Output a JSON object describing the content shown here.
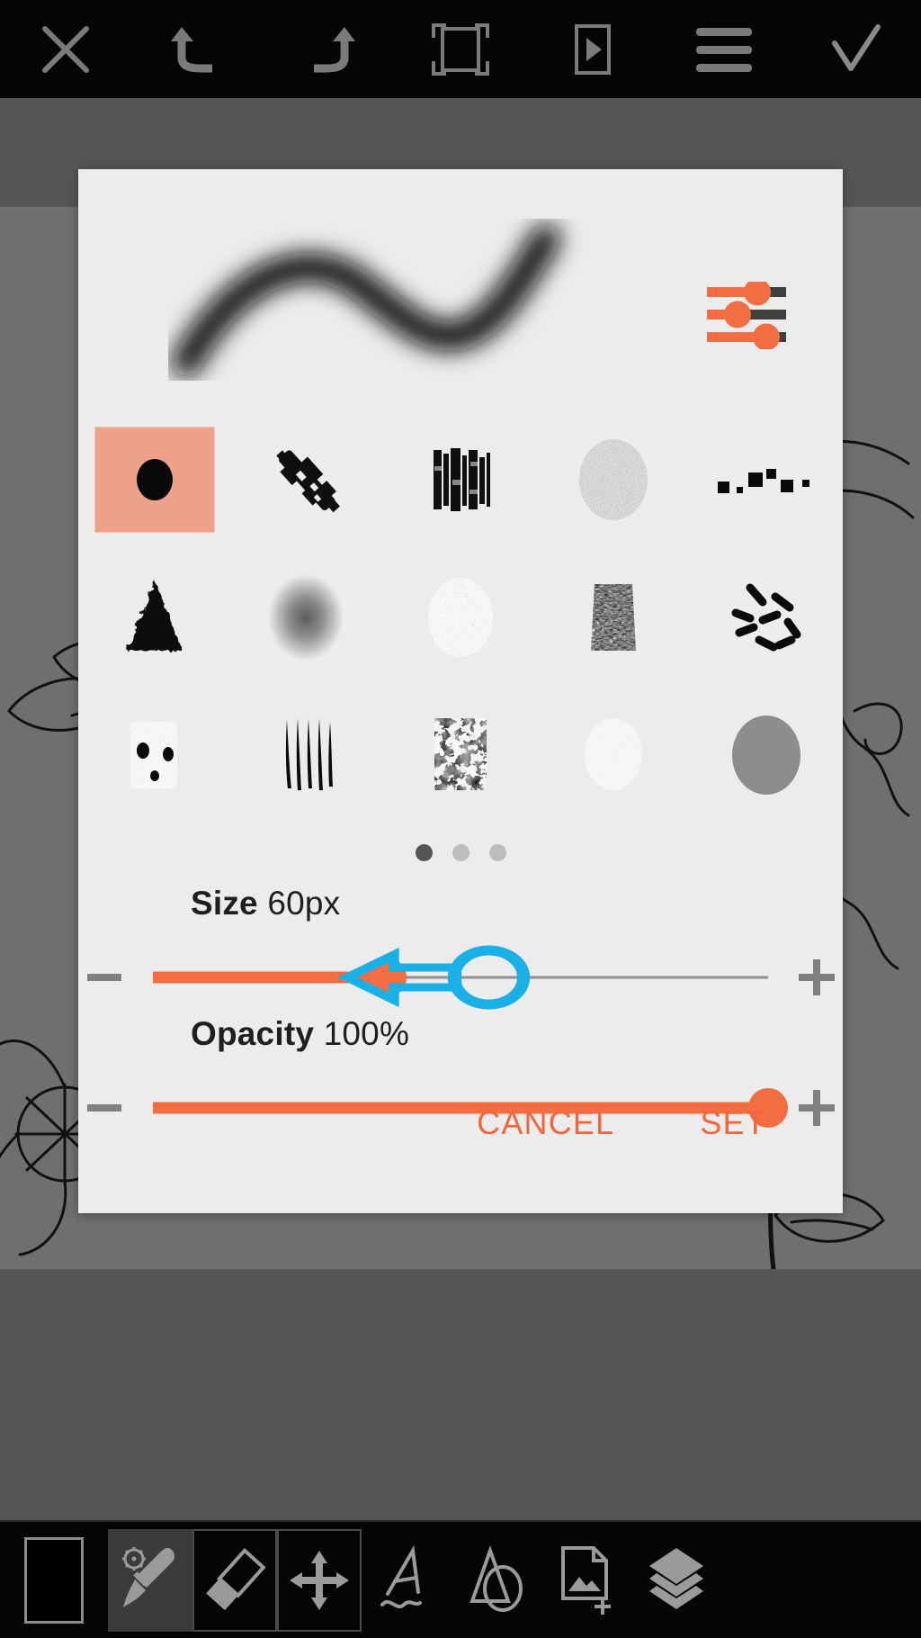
{
  "app": {
    "accent_color": "#f26d42",
    "dialog_bg": "#ececec",
    "toolbar_bg": "#050505",
    "canvas_bg": "#6f6f6f",
    "annotation_color": "#19b0e8",
    "selected_brush_highlight": "#eda18a"
  },
  "top_toolbar": {
    "items": [
      {
        "name": "close-icon",
        "label": "Close"
      },
      {
        "name": "undo-icon",
        "label": "Undo"
      },
      {
        "name": "redo-icon",
        "label": "Redo"
      },
      {
        "name": "crop-icon",
        "label": "Crop"
      },
      {
        "name": "preview-icon",
        "label": "Preview"
      },
      {
        "name": "menu-icon",
        "label": "Menu"
      },
      {
        "name": "confirm-check-icon",
        "label": "Done"
      }
    ]
  },
  "dialog": {
    "title": "Brush settings",
    "preview": {
      "name": "brush-stroke-preview"
    },
    "settings_icon": {
      "name": "brush-settings-sliders-icon",
      "label": "Brush settings"
    },
    "brushes": [
      {
        "id": "round",
        "label": "Round brush",
        "selected": true
      },
      {
        "id": "rough-diagonal",
        "label": "Rough diagonal brush",
        "selected": false
      },
      {
        "id": "bristle-streak",
        "label": "Bristle streak brush",
        "selected": false
      },
      {
        "id": "noise-circle",
        "label": "Noise circle brush",
        "selected": false
      },
      {
        "id": "square-dots",
        "label": "Square dots brush",
        "selected": false
      },
      {
        "id": "triangle",
        "label": "Triangle brush",
        "selected": false
      },
      {
        "id": "soft-airbrush",
        "label": "Soft airbrush",
        "selected": false
      },
      {
        "id": "speckle-circle",
        "label": "Speckle circle brush",
        "selected": false
      },
      {
        "id": "grunge-block",
        "label": "Grunge block brush",
        "selected": false
      },
      {
        "id": "dashes",
        "label": "Dashes brush",
        "selected": false
      },
      {
        "id": "grunge-square",
        "label": "Grunge square brush",
        "selected": false
      },
      {
        "id": "hair-lines",
        "label": "Hair lines brush",
        "selected": false
      },
      {
        "id": "dense-noise",
        "label": "Dense noise brush",
        "selected": false
      },
      {
        "id": "sparse-spray",
        "label": "Sparse spray brush",
        "selected": false
      },
      {
        "id": "solid-gray-circle",
        "label": "Solid soft circle brush",
        "selected": false
      }
    ],
    "pager": {
      "pages": 3,
      "active_index": 0
    },
    "size": {
      "label": "Size",
      "value_text": "60px",
      "value": 60,
      "fill_percent": 38,
      "minus_label": "Decrease size",
      "plus_label": "Increase size"
    },
    "opacity": {
      "label": "Opacity",
      "value_text": "100%",
      "value": 100,
      "fill_percent": 100,
      "minus_label": "Decrease opacity",
      "plus_label": "Increase opacity"
    },
    "actions": {
      "cancel_label": "CANCEL",
      "set_label": "SET"
    },
    "annotation": {
      "name": "drag-left-annotation",
      "description": "Blue circle highlight around size slider knob with arrow pointing left"
    }
  },
  "bottom_toolbar": {
    "items": [
      {
        "name": "color-swatch",
        "label": "Color",
        "active": false
      },
      {
        "name": "brush-tool",
        "label": "Brush",
        "active": true
      },
      {
        "name": "eraser-tool",
        "label": "Eraser",
        "active": false
      },
      {
        "name": "transform-tool",
        "label": "Transform",
        "active": false
      },
      {
        "name": "text-tool",
        "label": "Text",
        "active": false
      },
      {
        "name": "shape-tool",
        "label": "Shapes",
        "active": false
      },
      {
        "name": "add-image-tool",
        "label": "Add photo",
        "active": false
      },
      {
        "name": "layers-tool",
        "label": "Layers",
        "active": false
      }
    ]
  }
}
